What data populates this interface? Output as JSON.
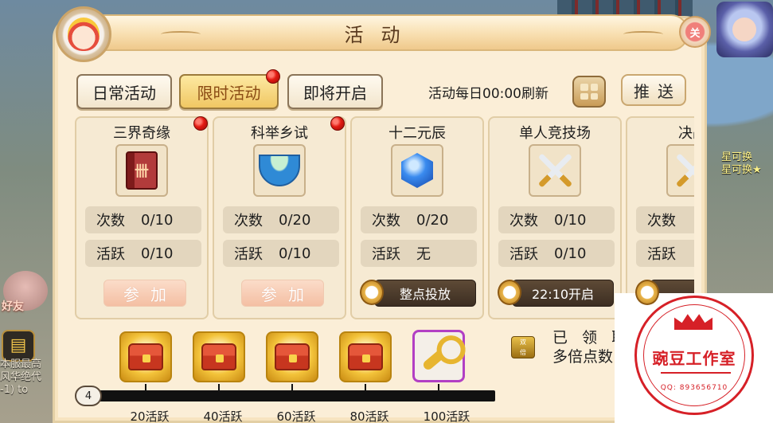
{
  "window": {
    "title": "活动",
    "close_label": "关"
  },
  "tabs": [
    {
      "label": "日常活动",
      "active": false
    },
    {
      "label": "限时活动",
      "active": true,
      "has_alert": true
    },
    {
      "label": "即将开启",
      "active": false
    }
  ],
  "refresh_text": "活动每日00:00刷新",
  "push_button": "推送",
  "cards": [
    {
      "name": "三界奇缘",
      "icon": "book-icon",
      "count_label": "次数",
      "count_value": "0/10",
      "active_label": "活跃",
      "active_value": "0/10",
      "action": "参加",
      "action_type": "join",
      "has_alert": true
    },
    {
      "name": "科举乡试",
      "icon": "bowl-icon",
      "count_label": "次数",
      "count_value": "0/20",
      "active_label": "活跃",
      "active_value": "0/10",
      "action": "参加",
      "action_type": "join",
      "has_alert": true
    },
    {
      "name": "十二元辰",
      "icon": "gem-icon",
      "count_label": "次数",
      "count_value": "0/20",
      "active_label": "活跃",
      "active_value": "无",
      "action": "整点投放",
      "action_type": "time",
      "has_alert": false
    },
    {
      "name": "单人竞技场",
      "icon": "swords-icon",
      "count_label": "次数",
      "count_value": "0/10",
      "active_label": "活跃",
      "active_value": "0/10",
      "action": "22:10开启",
      "action_type": "time",
      "has_alert": false
    },
    {
      "name": "决战",
      "icon": "swords-icon",
      "count_label": "次数",
      "count_value": "",
      "active_label": "活跃",
      "active_value": "",
      "action": "",
      "action_type": "time",
      "has_alert": false
    }
  ],
  "rewards": {
    "current_activity": "4",
    "progress_fraction": 0.04,
    "milestones": [
      "20活跃",
      "40活跃",
      "60活跃",
      "80活跃",
      "100活跃"
    ],
    "reward_icons": [
      "chest-icon",
      "chest-icon",
      "chest-icon",
      "chest-icon",
      "key-icon"
    ]
  },
  "claimed_text_line1": "已 领 取",
  "claimed_text_line2": "多倍点数",
  "background": {
    "left_text": [
      "本服最高",
      "风华绝代",
      "-1) to"
    ],
    "right_text": [
      "星可换",
      "星可换★"
    ],
    "friend_label": "好友"
  },
  "watermark": {
    "title": "豌豆工作室",
    "qq": "QQ: 893656710"
  },
  "colors": {
    "panel_bg": "#fbeed7",
    "active_tab": "#f0c763",
    "alert_red": "#e31b12",
    "progress_fill": "#8bc34a",
    "watermark_red": "#d62027"
  }
}
